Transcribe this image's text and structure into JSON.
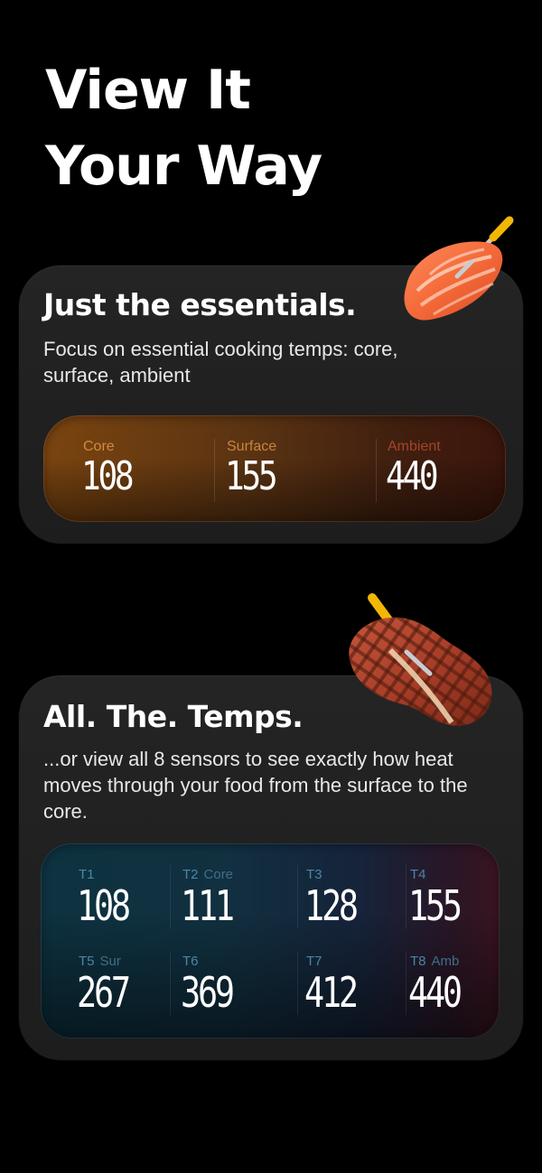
{
  "hero": {
    "line1": "View It",
    "line2": "Your Way"
  },
  "essentials_card": {
    "title": "Just the essentials.",
    "description": "Focus on essential cooking temps: core, surface, ambient",
    "readings": [
      {
        "label": "Core",
        "value": "108",
        "label_color": "#d48a3c"
      },
      {
        "label": "Surface",
        "value": "155",
        "label_color": "#c9843e"
      },
      {
        "label": "Ambient",
        "value": "440",
        "label_color": "#a3452b"
      }
    ],
    "illustration": "salmon-with-probe-icon"
  },
  "all_temps_card": {
    "title": "All. The. Temps.",
    "description": "...or view all 8 sensors to see exactly how heat moves through your food from the surface to the core.",
    "sensors": [
      {
        "label": "T1",
        "sub": "",
        "value": "108"
      },
      {
        "label": "T2",
        "sub": "Core",
        "value": "111"
      },
      {
        "label": "T3",
        "sub": "",
        "value": "128"
      },
      {
        "label": "T4",
        "sub": "",
        "value": "155"
      },
      {
        "label": "T5",
        "sub": "Sur",
        "value": "267"
      },
      {
        "label": "T6",
        "sub": "",
        "value": "369"
      },
      {
        "label": "T7",
        "sub": "",
        "value": "412"
      },
      {
        "label": "T8",
        "sub": "Amb",
        "value": "440"
      }
    ],
    "illustration": "steak-with-probe-icon"
  },
  "colors": {
    "background": "#000000",
    "card": "#222222",
    "ess_panel_start": "#7a4410",
    "ess_panel_end": "#3a150c",
    "all_panel_start": "#0d3240",
    "all_panel_end": "#3a1420"
  }
}
